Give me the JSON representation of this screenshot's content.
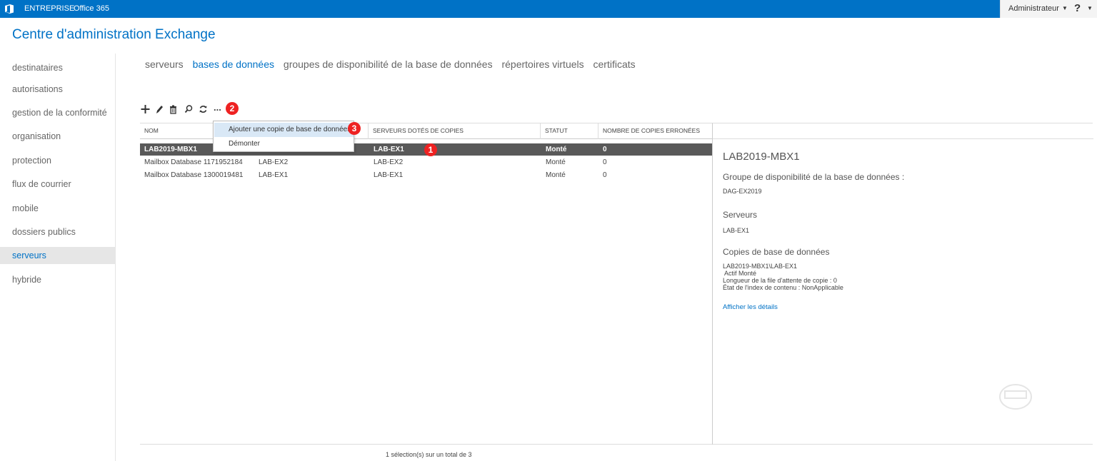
{
  "topbar": {
    "brand": "ENTREPRISE",
    "product": "Office 365",
    "user_menu": "Administrateur",
    "help_label": "?"
  },
  "app_title": "Centre d'administration Exchange",
  "leftnav": {
    "items": [
      {
        "label": "destinataires"
      },
      {
        "label": "autorisations"
      },
      {
        "label": "gestion de la conformité"
      },
      {
        "label": "organisation"
      },
      {
        "label": "protection"
      },
      {
        "label": "flux de courrier"
      },
      {
        "label": "mobile"
      },
      {
        "label": "dossiers publics"
      },
      {
        "label": "serveurs",
        "active": true
      },
      {
        "label": "hybride"
      }
    ]
  },
  "tabs": [
    {
      "label": "serveurs"
    },
    {
      "label": "bases de données",
      "active": true
    },
    {
      "label": "groupes de disponibilité de la base de données"
    },
    {
      "label": "répertoires virtuels"
    },
    {
      "label": "certificats"
    }
  ],
  "toolbar": {
    "icons": [
      "add-icon",
      "edit-icon",
      "delete-icon",
      "search-icon",
      "refresh-icon",
      "more-icon"
    ],
    "more_label": "..."
  },
  "annotations": {
    "badge1": "1",
    "badge2": "2",
    "badge3": "3",
    "color": "#e22222"
  },
  "menu": {
    "items": [
      {
        "label": "Ajouter une copie de base de données",
        "hover": true
      },
      {
        "label": "Démonter"
      }
    ]
  },
  "grid": {
    "columns": [
      "NOM",
      "",
      "SERVEURS DOTÉS DE COPIES",
      "STATUT",
      "NOMBRE DE COPIES ERRONÉES"
    ],
    "rows": [
      {
        "name": "LAB2019-MBX1",
        "server": "",
        "copies": "LAB-EX1",
        "status": "Monté",
        "errors": "0",
        "selected": true
      },
      {
        "name": "Mailbox Database 1171952184",
        "server": "LAB-EX2",
        "copies": "LAB-EX2",
        "status": "Monté",
        "errors": "0"
      },
      {
        "name": "Mailbox Database 1300019481",
        "server": "LAB-EX1",
        "copies": "LAB-EX1",
        "status": "Monté",
        "errors": "0"
      }
    ],
    "status": "1 sélection(s) sur un total de 3"
  },
  "detail": {
    "title": "LAB2019-MBX1",
    "dag_label": "Groupe de disponibilité de la base de données :",
    "dag_value": "DAG-EX2019",
    "servers_label": "Serveurs",
    "servers_value": "LAB-EX1",
    "copies_label": "Copies de base de données",
    "copy_name": "LAB2019-MBX1\\LAB-EX1",
    "copy_state": "Actif Monté",
    "copy_queue": "Longueur de la file d'attente de copie : 0",
    "copy_index": "État de l'index de contenu : NonApplicable",
    "details_link": "Afficher les détails"
  },
  "colors": {
    "accent": "#0072c6",
    "selected_row": "#595959",
    "nav_active_bg": "#e6e6e6",
    "menu_hover": "#d9e8f6"
  }
}
